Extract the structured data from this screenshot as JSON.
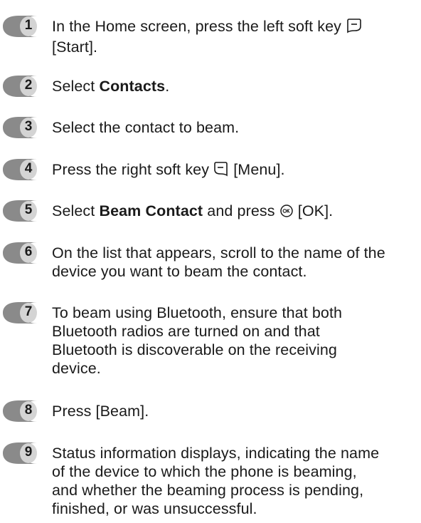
{
  "steps": [
    {
      "number": "1",
      "line1_text": "In the Home screen, press the left soft key ",
      "line2_text": "[Start].",
      "icon": "left-soft-key-icon"
    },
    {
      "number": "2",
      "pre": "Select ",
      "bold": "Contacts",
      "post": "."
    },
    {
      "number": "3",
      "text": "Select the contact to beam."
    },
    {
      "number": "4",
      "pre": "Press the right soft key ",
      "icon": "right-soft-key-icon",
      "post": " [Menu]."
    },
    {
      "number": "5",
      "pre": "Select ",
      "bold": "Beam Contact",
      "mid": " and press ",
      "icon": "ok-key-icon",
      "post": " [OK]."
    },
    {
      "number": "6",
      "lines": [
        "On the list that appears, scroll to the name of the",
        "device you want to beam the contact."
      ]
    },
    {
      "number": "7",
      "lines": [
        "To beam using Bluetooth, ensure that both",
        "Bluetooth radios are turned on and that",
        "Bluetooth is discoverable on the receiving",
        "device."
      ]
    },
    {
      "number": "8",
      "text": "Press [Beam]."
    },
    {
      "number": "9",
      "lines": [
        "Status information displays, indicating the name",
        "of the device to which the phone is beaming,",
        "and whether the beaming process is pending,",
        "finished, or was unsuccessful."
      ]
    }
  ],
  "colors": {
    "badge_dark": "#8a8a8a",
    "badge_light": "#d4d4d4",
    "text": "#1a1a1a"
  }
}
